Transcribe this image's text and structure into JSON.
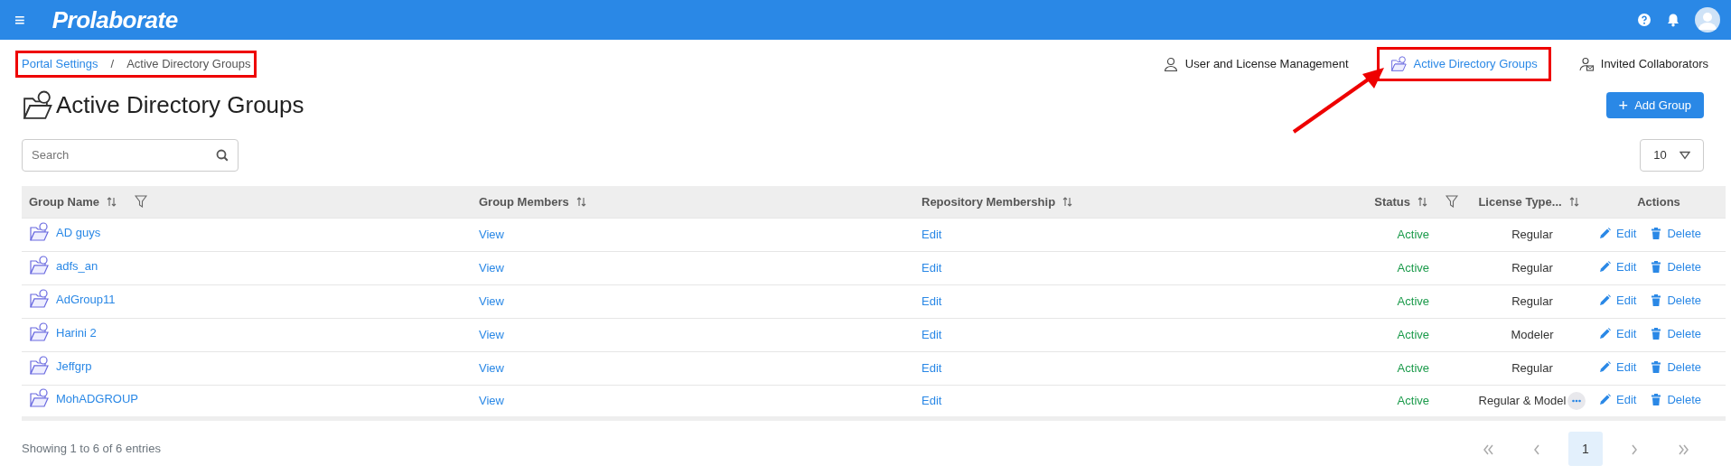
{
  "navbar": {
    "menu_glyph": "≡",
    "brand": "Prolaborate"
  },
  "breadcrumb": {
    "highlighted": true,
    "items": [
      {
        "label": "Portal Settings",
        "kind": "link"
      },
      {
        "label": "/",
        "kind": "separator"
      },
      {
        "label": "Active Directory Groups",
        "kind": "current"
      }
    ]
  },
  "tabs": [
    {
      "label": "User and License Management",
      "kind": "user",
      "selected": false,
      "highlighted": false
    },
    {
      "label": "Active Directory Groups",
      "kind": "folder",
      "selected": true,
      "highlighted": true
    },
    {
      "label": "Invited Collaborators",
      "kind": "invite",
      "selected": false,
      "highlighted": false
    }
  ],
  "pointer_arrow": true,
  "page_title": "Active Directory Groups",
  "add_button": {
    "glyph": "+",
    "label": "Add Group"
  },
  "search": {
    "placeholder": "Search"
  },
  "page_size": "10",
  "table": {
    "columns": [
      {
        "label": "Group Name",
        "sortable": true,
        "filter": true
      },
      {
        "label": "Group Members",
        "sortable": true,
        "filter": false
      },
      {
        "label": "Repository Membership",
        "sortable": true,
        "filter": false
      },
      {
        "label": "Status",
        "sortable": true,
        "filter": true
      },
      {
        "label": "License Type...",
        "sortable": true,
        "filter": false
      },
      {
        "label": "Actions",
        "sortable": false,
        "filter": false
      }
    ],
    "rows": [
      {
        "name": "AD guys",
        "members": "View",
        "repository": "Edit",
        "status": "Active",
        "license": "Regular",
        "more": false,
        "edit": "Edit",
        "delete": "Delete"
      },
      {
        "name": "adfs_an",
        "members": "View",
        "repository": "Edit",
        "status": "Active",
        "license": "Regular",
        "more": false,
        "edit": "Edit",
        "delete": "Delete"
      },
      {
        "name": "AdGroup11",
        "members": "View",
        "repository": "Edit",
        "status": "Active",
        "license": "Regular",
        "more": false,
        "edit": "Edit",
        "delete": "Delete"
      },
      {
        "name": "Harini 2",
        "members": "View",
        "repository": "Edit",
        "status": "Active",
        "license": "Modeler",
        "more": false,
        "edit": "Edit",
        "delete": "Delete"
      },
      {
        "name": "Jeffgrp",
        "members": "View",
        "repository": "Edit",
        "status": "Active",
        "license": "Regular",
        "more": false,
        "edit": "Edit",
        "delete": "Delete"
      },
      {
        "name": "MohADGROUP",
        "members": "View",
        "repository": "Edit",
        "status": "Active",
        "license": "Regular & Model",
        "more": true,
        "edit": "Edit",
        "delete": "Delete"
      }
    ]
  },
  "footer": {
    "summary": "Showing 1 to 6 of 6 entries"
  },
  "pagination": [
    {
      "kind": "first",
      "selected": false
    },
    {
      "kind": "prev",
      "selected": false
    },
    {
      "label": "1",
      "kind": "page",
      "selected": true
    },
    {
      "kind": "next",
      "selected": false
    },
    {
      "kind": "last",
      "selected": false
    }
  ]
}
